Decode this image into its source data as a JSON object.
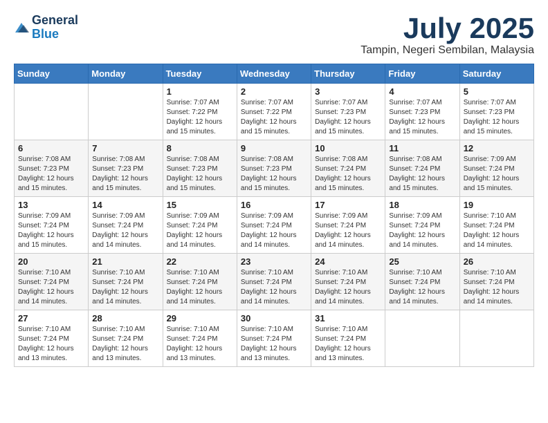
{
  "logo": {
    "general": "General",
    "blue": "Blue"
  },
  "title": {
    "month_year": "July 2025",
    "location": "Tampin, Negeri Sembilan, Malaysia"
  },
  "days_of_week": [
    "Sunday",
    "Monday",
    "Tuesday",
    "Wednesday",
    "Thursday",
    "Friday",
    "Saturday"
  ],
  "weeks": [
    [
      {
        "day": "",
        "info": ""
      },
      {
        "day": "",
        "info": ""
      },
      {
        "day": "1",
        "info": "Sunrise: 7:07 AM\nSunset: 7:22 PM\nDaylight: 12 hours and 15 minutes."
      },
      {
        "day": "2",
        "info": "Sunrise: 7:07 AM\nSunset: 7:22 PM\nDaylight: 12 hours and 15 minutes."
      },
      {
        "day": "3",
        "info": "Sunrise: 7:07 AM\nSunset: 7:23 PM\nDaylight: 12 hours and 15 minutes."
      },
      {
        "day": "4",
        "info": "Sunrise: 7:07 AM\nSunset: 7:23 PM\nDaylight: 12 hours and 15 minutes."
      },
      {
        "day": "5",
        "info": "Sunrise: 7:07 AM\nSunset: 7:23 PM\nDaylight: 12 hours and 15 minutes."
      }
    ],
    [
      {
        "day": "6",
        "info": "Sunrise: 7:08 AM\nSunset: 7:23 PM\nDaylight: 12 hours and 15 minutes."
      },
      {
        "day": "7",
        "info": "Sunrise: 7:08 AM\nSunset: 7:23 PM\nDaylight: 12 hours and 15 minutes."
      },
      {
        "day": "8",
        "info": "Sunrise: 7:08 AM\nSunset: 7:23 PM\nDaylight: 12 hours and 15 minutes."
      },
      {
        "day": "9",
        "info": "Sunrise: 7:08 AM\nSunset: 7:23 PM\nDaylight: 12 hours and 15 minutes."
      },
      {
        "day": "10",
        "info": "Sunrise: 7:08 AM\nSunset: 7:24 PM\nDaylight: 12 hours and 15 minutes."
      },
      {
        "day": "11",
        "info": "Sunrise: 7:08 AM\nSunset: 7:24 PM\nDaylight: 12 hours and 15 minutes."
      },
      {
        "day": "12",
        "info": "Sunrise: 7:09 AM\nSunset: 7:24 PM\nDaylight: 12 hours and 15 minutes."
      }
    ],
    [
      {
        "day": "13",
        "info": "Sunrise: 7:09 AM\nSunset: 7:24 PM\nDaylight: 12 hours and 15 minutes."
      },
      {
        "day": "14",
        "info": "Sunrise: 7:09 AM\nSunset: 7:24 PM\nDaylight: 12 hours and 14 minutes."
      },
      {
        "day": "15",
        "info": "Sunrise: 7:09 AM\nSunset: 7:24 PM\nDaylight: 12 hours and 14 minutes."
      },
      {
        "day": "16",
        "info": "Sunrise: 7:09 AM\nSunset: 7:24 PM\nDaylight: 12 hours and 14 minutes."
      },
      {
        "day": "17",
        "info": "Sunrise: 7:09 AM\nSunset: 7:24 PM\nDaylight: 12 hours and 14 minutes."
      },
      {
        "day": "18",
        "info": "Sunrise: 7:09 AM\nSunset: 7:24 PM\nDaylight: 12 hours and 14 minutes."
      },
      {
        "day": "19",
        "info": "Sunrise: 7:10 AM\nSunset: 7:24 PM\nDaylight: 12 hours and 14 minutes."
      }
    ],
    [
      {
        "day": "20",
        "info": "Sunrise: 7:10 AM\nSunset: 7:24 PM\nDaylight: 12 hours and 14 minutes."
      },
      {
        "day": "21",
        "info": "Sunrise: 7:10 AM\nSunset: 7:24 PM\nDaylight: 12 hours and 14 minutes."
      },
      {
        "day": "22",
        "info": "Sunrise: 7:10 AM\nSunset: 7:24 PM\nDaylight: 12 hours and 14 minutes."
      },
      {
        "day": "23",
        "info": "Sunrise: 7:10 AM\nSunset: 7:24 PM\nDaylight: 12 hours and 14 minutes."
      },
      {
        "day": "24",
        "info": "Sunrise: 7:10 AM\nSunset: 7:24 PM\nDaylight: 12 hours and 14 minutes."
      },
      {
        "day": "25",
        "info": "Sunrise: 7:10 AM\nSunset: 7:24 PM\nDaylight: 12 hours and 14 minutes."
      },
      {
        "day": "26",
        "info": "Sunrise: 7:10 AM\nSunset: 7:24 PM\nDaylight: 12 hours and 14 minutes."
      }
    ],
    [
      {
        "day": "27",
        "info": "Sunrise: 7:10 AM\nSunset: 7:24 PM\nDaylight: 12 hours and 13 minutes."
      },
      {
        "day": "28",
        "info": "Sunrise: 7:10 AM\nSunset: 7:24 PM\nDaylight: 12 hours and 13 minutes."
      },
      {
        "day": "29",
        "info": "Sunrise: 7:10 AM\nSunset: 7:24 PM\nDaylight: 12 hours and 13 minutes."
      },
      {
        "day": "30",
        "info": "Sunrise: 7:10 AM\nSunset: 7:24 PM\nDaylight: 12 hours and 13 minutes."
      },
      {
        "day": "31",
        "info": "Sunrise: 7:10 AM\nSunset: 7:24 PM\nDaylight: 12 hours and 13 minutes."
      },
      {
        "day": "",
        "info": ""
      },
      {
        "day": "",
        "info": ""
      }
    ]
  ]
}
